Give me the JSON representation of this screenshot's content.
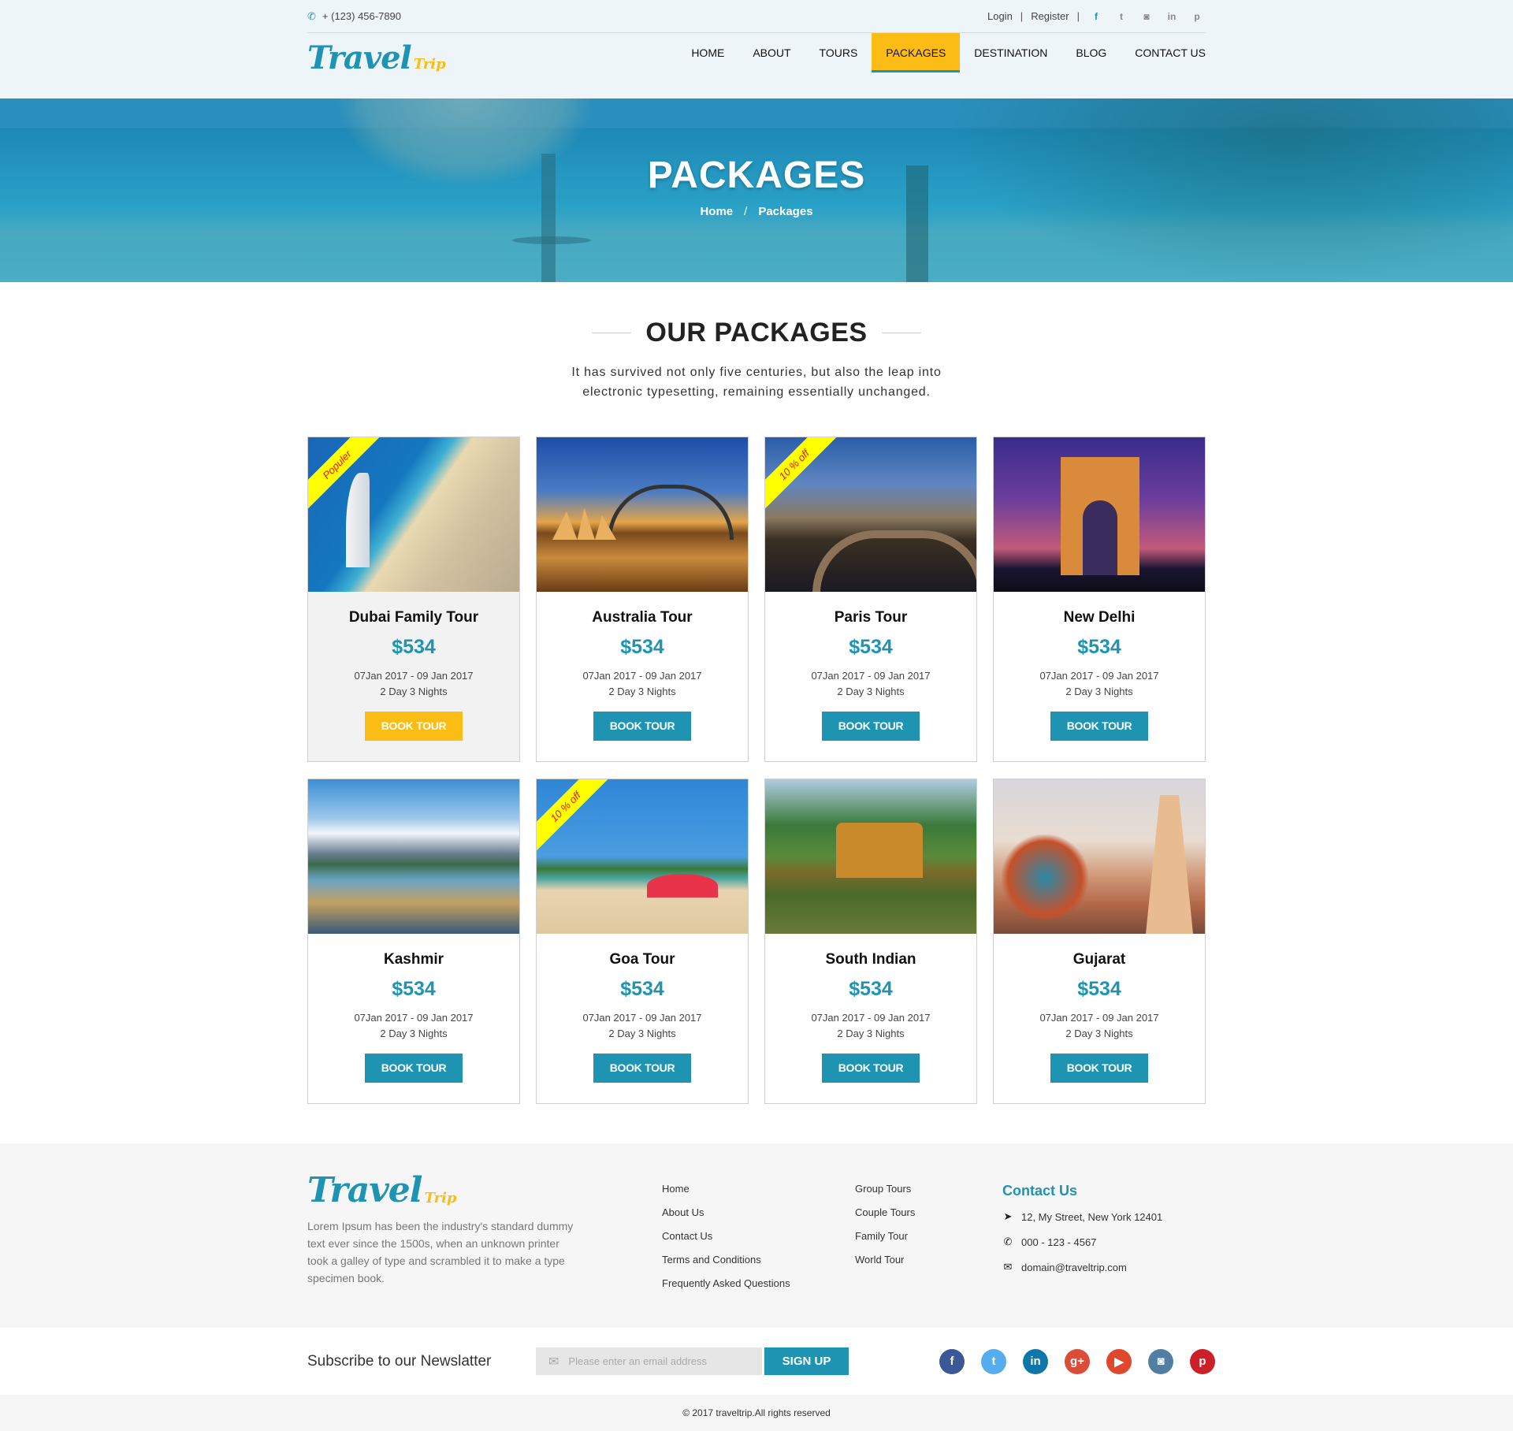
{
  "topbar": {
    "phone": "+ (123) 456-7890",
    "login": "Login",
    "register": "Register",
    "separator": "|",
    "socials": [
      {
        "name": "facebook-icon",
        "glyph": "f"
      },
      {
        "name": "twitter-icon",
        "glyph": "t"
      },
      {
        "name": "instagram-icon",
        "glyph": "◙"
      },
      {
        "name": "linkedin-icon",
        "glyph": "in"
      },
      {
        "name": "pinterest-icon",
        "glyph": "p"
      }
    ]
  },
  "brand": {
    "name_main": "Travel",
    "name_accent": "Trip"
  },
  "nav": {
    "items": [
      "HOME",
      "ABOUT",
      "TOURS",
      "PACKAGES",
      "DESTINATION",
      "BLOG",
      "CONTACT US"
    ],
    "active": "PACKAGES"
  },
  "hero": {
    "title": "PACKAGES",
    "breadcrumb": {
      "home": "Home",
      "separator": "/",
      "current": "Packages"
    }
  },
  "section": {
    "title": "OUR PACKAGES",
    "subtitle_line1": "It has survived not only five centuries, but also the leap into",
    "subtitle_line2": "electronic typesetting, remaining essentially unchanged."
  },
  "packages": [
    {
      "title": "Dubai Family Tour",
      "price": "$534",
      "dates": "07Jan 2017 - 09 Jan 2017",
      "duration": "2 Day 3 Nights",
      "button": "BOOK TOUR",
      "badge": "Populer",
      "scene": "dubai",
      "highlight": true
    },
    {
      "title": "Australia Tour",
      "price": "$534",
      "dates": "07Jan 2017 - 09 Jan 2017",
      "duration": "2 Day 3 Nights",
      "button": "BOOK TOUR",
      "badge": null,
      "scene": "australia",
      "highlight": false
    },
    {
      "title": "Paris Tour",
      "price": "$534",
      "dates": "07Jan 2017 - 09 Jan 2017",
      "duration": "2 Day 3 Nights",
      "button": "BOOK TOUR",
      "badge": "10 % off",
      "scene": "paris",
      "highlight": false
    },
    {
      "title": "New Delhi",
      "price": "$534",
      "dates": "07Jan 2017 - 09 Jan 2017",
      "duration": "2 Day 3 Nights",
      "button": "BOOK TOUR",
      "badge": null,
      "scene": "delhi",
      "highlight": false
    },
    {
      "title": "Kashmir",
      "price": "$534",
      "dates": "07Jan 2017 - 09 Jan 2017",
      "duration": "2 Day 3 Nights",
      "button": "BOOK TOUR",
      "badge": null,
      "scene": "kashmir",
      "highlight": false
    },
    {
      "title": "Goa Tour",
      "price": "$534",
      "dates": "07Jan 2017 - 09 Jan 2017",
      "duration": "2 Day 3 Nights",
      "button": "BOOK TOUR",
      "badge": "10 % off",
      "scene": "goa",
      "highlight": false
    },
    {
      "title": "South Indian",
      "price": "$534",
      "dates": "07Jan 2017 - 09 Jan 2017",
      "duration": "2 Day 3 Nights",
      "button": "BOOK TOUR",
      "badge": null,
      "scene": "south",
      "highlight": false
    },
    {
      "title": "Gujarat",
      "price": "$534",
      "dates": "07Jan 2017 - 09 Jan 2017",
      "duration": "2 Day 3 Nights",
      "button": "BOOK TOUR",
      "badge": null,
      "scene": "gujarat",
      "highlight": false
    }
  ],
  "footer": {
    "about": "Lorem Ipsum has been the industry's standard dummy text ever since the 1500s, when an unknown printer took a galley of type and scrambled it to make a type specimen book.",
    "links_col1": [
      "Home",
      "About Us",
      "Contact Us",
      "Terms and Conditions",
      "Frequently Asked Questions"
    ],
    "links_col2": [
      "Group Tours",
      "Couple Tours",
      "Family Tour",
      "World Tour"
    ],
    "contact": {
      "title": "Contact Us",
      "address": "12, My Street, New York 12401",
      "phone": "000 - 123 - 4567",
      "email": "domain@traveltrip.com"
    }
  },
  "newsletter": {
    "label": "Subscribe to our Newslatter",
    "placeholder": "Please enter an email address",
    "value": "",
    "button": "SIGN UP",
    "socials": [
      {
        "name": "facebook-icon",
        "glyph": "f",
        "color": "#3b5998"
      },
      {
        "name": "twitter-icon",
        "glyph": "t",
        "color": "#55acee"
      },
      {
        "name": "linkedin-icon",
        "glyph": "in",
        "color": "#0e76a8"
      },
      {
        "name": "google-plus-icon",
        "glyph": "g+",
        "color": "#dd4b39"
      },
      {
        "name": "youtube-icon",
        "glyph": "▶",
        "color": "#e0482e"
      },
      {
        "name": "instagram-icon",
        "glyph": "◙",
        "color": "#517fa4"
      },
      {
        "name": "pinterest-icon",
        "glyph": "p",
        "color": "#cb2027"
      }
    ]
  },
  "copyright": "© 2017 traveltrip.All rights reserved",
  "colors": {
    "primary": "#1e94b2",
    "accent": "#fbbc15",
    "ribbon": "#ffff00",
    "ribbon_text": "#e8140e"
  }
}
